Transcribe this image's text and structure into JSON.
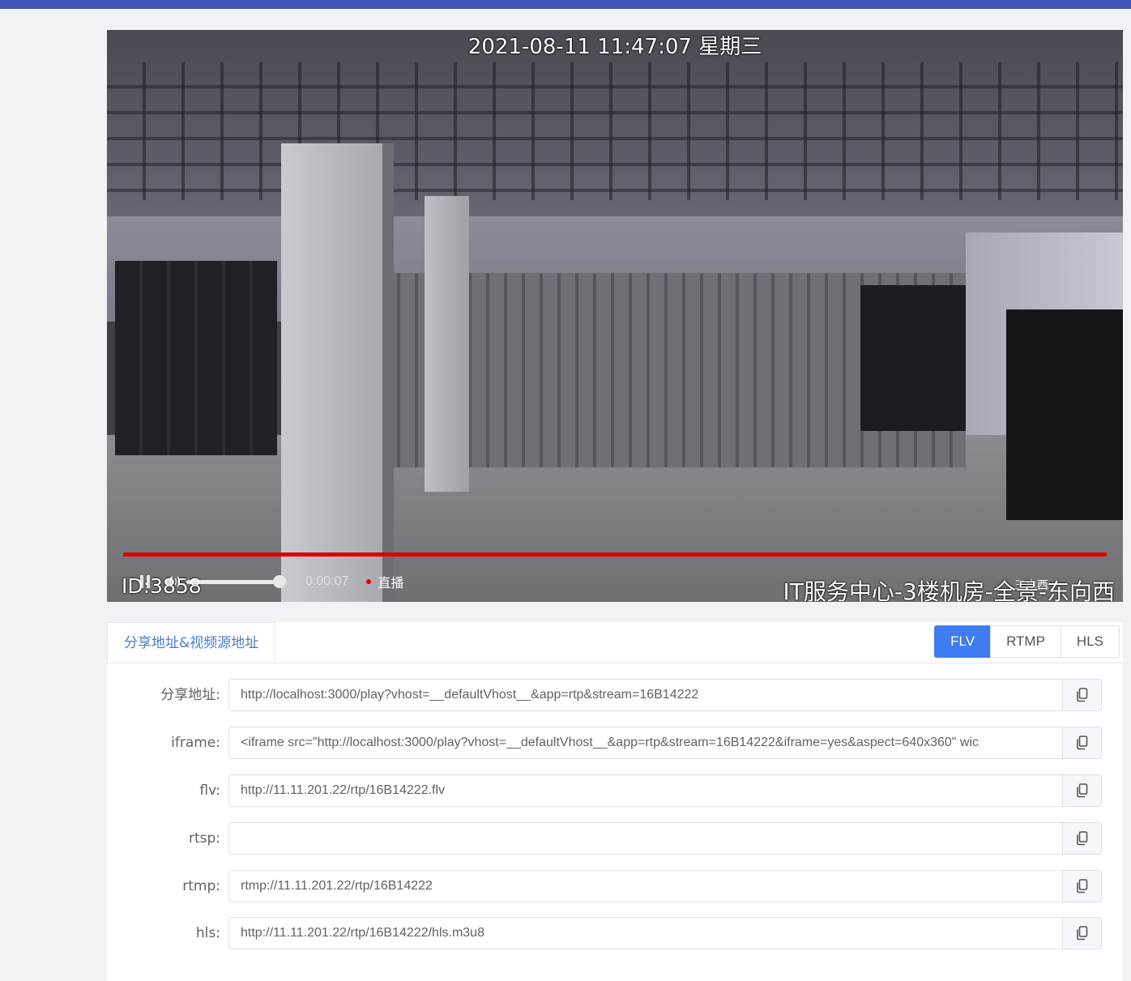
{
  "video": {
    "osd_datetime": "2021-08-11 11:47:07 星期三",
    "osd_location": "IT服务中心-3楼机房-全景-东向西",
    "osd_id": "ID:3858",
    "current_time": "0:00:07",
    "live_label": "直播",
    "osd_overlay_small": "三电西",
    "progress_fraction": 1.0,
    "volume_fraction": 1.0,
    "progress_color": "#e00000"
  },
  "tabs": {
    "active_label": "分享地址&视频源地址"
  },
  "formats": [
    "FLV",
    "RTMP",
    "HLS"
  ],
  "active_format": "FLV",
  "fields": [
    {
      "label": "分享地址:",
      "value": "http://localhost:3000/play?vhost=__defaultVhost__&app=rtp&stream=16B14222"
    },
    {
      "label": "iframe:",
      "value": "<iframe src=\"http://localhost:3000/play?vhost=__defaultVhost__&app=rtp&stream=16B14222&iframe=yes&aspect=640x360\" wic"
    },
    {
      "label": "flv:",
      "value": "http://11.11.201.22/rtp/16B14222.flv"
    },
    {
      "label": "rtsp:",
      "value": ""
    },
    {
      "label": "rtmp:",
      "value": "rtmp://11.11.201.22/rtp/16B14222"
    },
    {
      "label": "hls:",
      "value": "http://11.11.201.22/rtp/16B14222/hls.m3u8"
    }
  ],
  "colors": {
    "accent": "#3f7cf1",
    "header_bar": "#4254b8",
    "tab_text": "#4a7bd0"
  }
}
